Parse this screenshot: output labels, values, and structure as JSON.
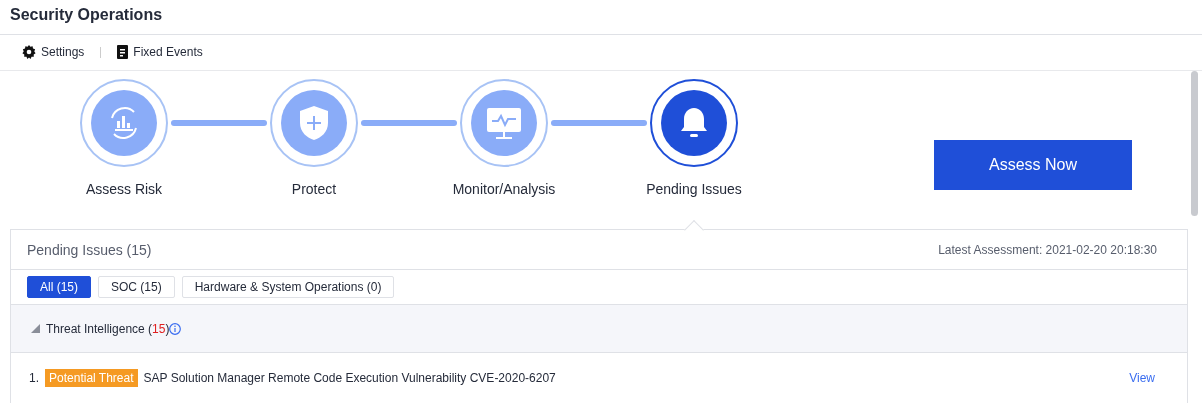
{
  "page_title": "Security Operations",
  "toolbar": [
    {
      "kind": "settings",
      "label": "Settings"
    },
    {
      "kind": "document",
      "label": "Fixed Events"
    }
  ],
  "steps": [
    {
      "kind": "assess",
      "label": "Assess Risk",
      "selected": false
    },
    {
      "kind": "protect",
      "label": "Protect",
      "selected": false
    },
    {
      "kind": "monitor",
      "label": "Monitor/Analysis",
      "selected": false
    },
    {
      "kind": "alert",
      "label": "Pending Issues",
      "selected": true
    }
  ],
  "assess_button": "Assess Now",
  "panel": {
    "title": "Pending Issues (15)",
    "latest_assessment": "Latest Assessment: 2021-02-20 20:18:30",
    "filters": [
      {
        "label": "All (15)",
        "selected": true
      },
      {
        "label": "SOC (15)",
        "selected": false
      },
      {
        "label": "Hardware & System Operations (0)",
        "selected": false
      }
    ],
    "groups": [
      {
        "name": "Threat Intelligence",
        "count": "(15)",
        "expanded": true,
        "issues": [
          {
            "index": "1.",
            "badge": "Potential Threat",
            "title": "SAP Solution Manager Remote Code Execution Vulnerability CVE-2020-6207",
            "action": "View"
          }
        ]
      }
    ]
  }
}
